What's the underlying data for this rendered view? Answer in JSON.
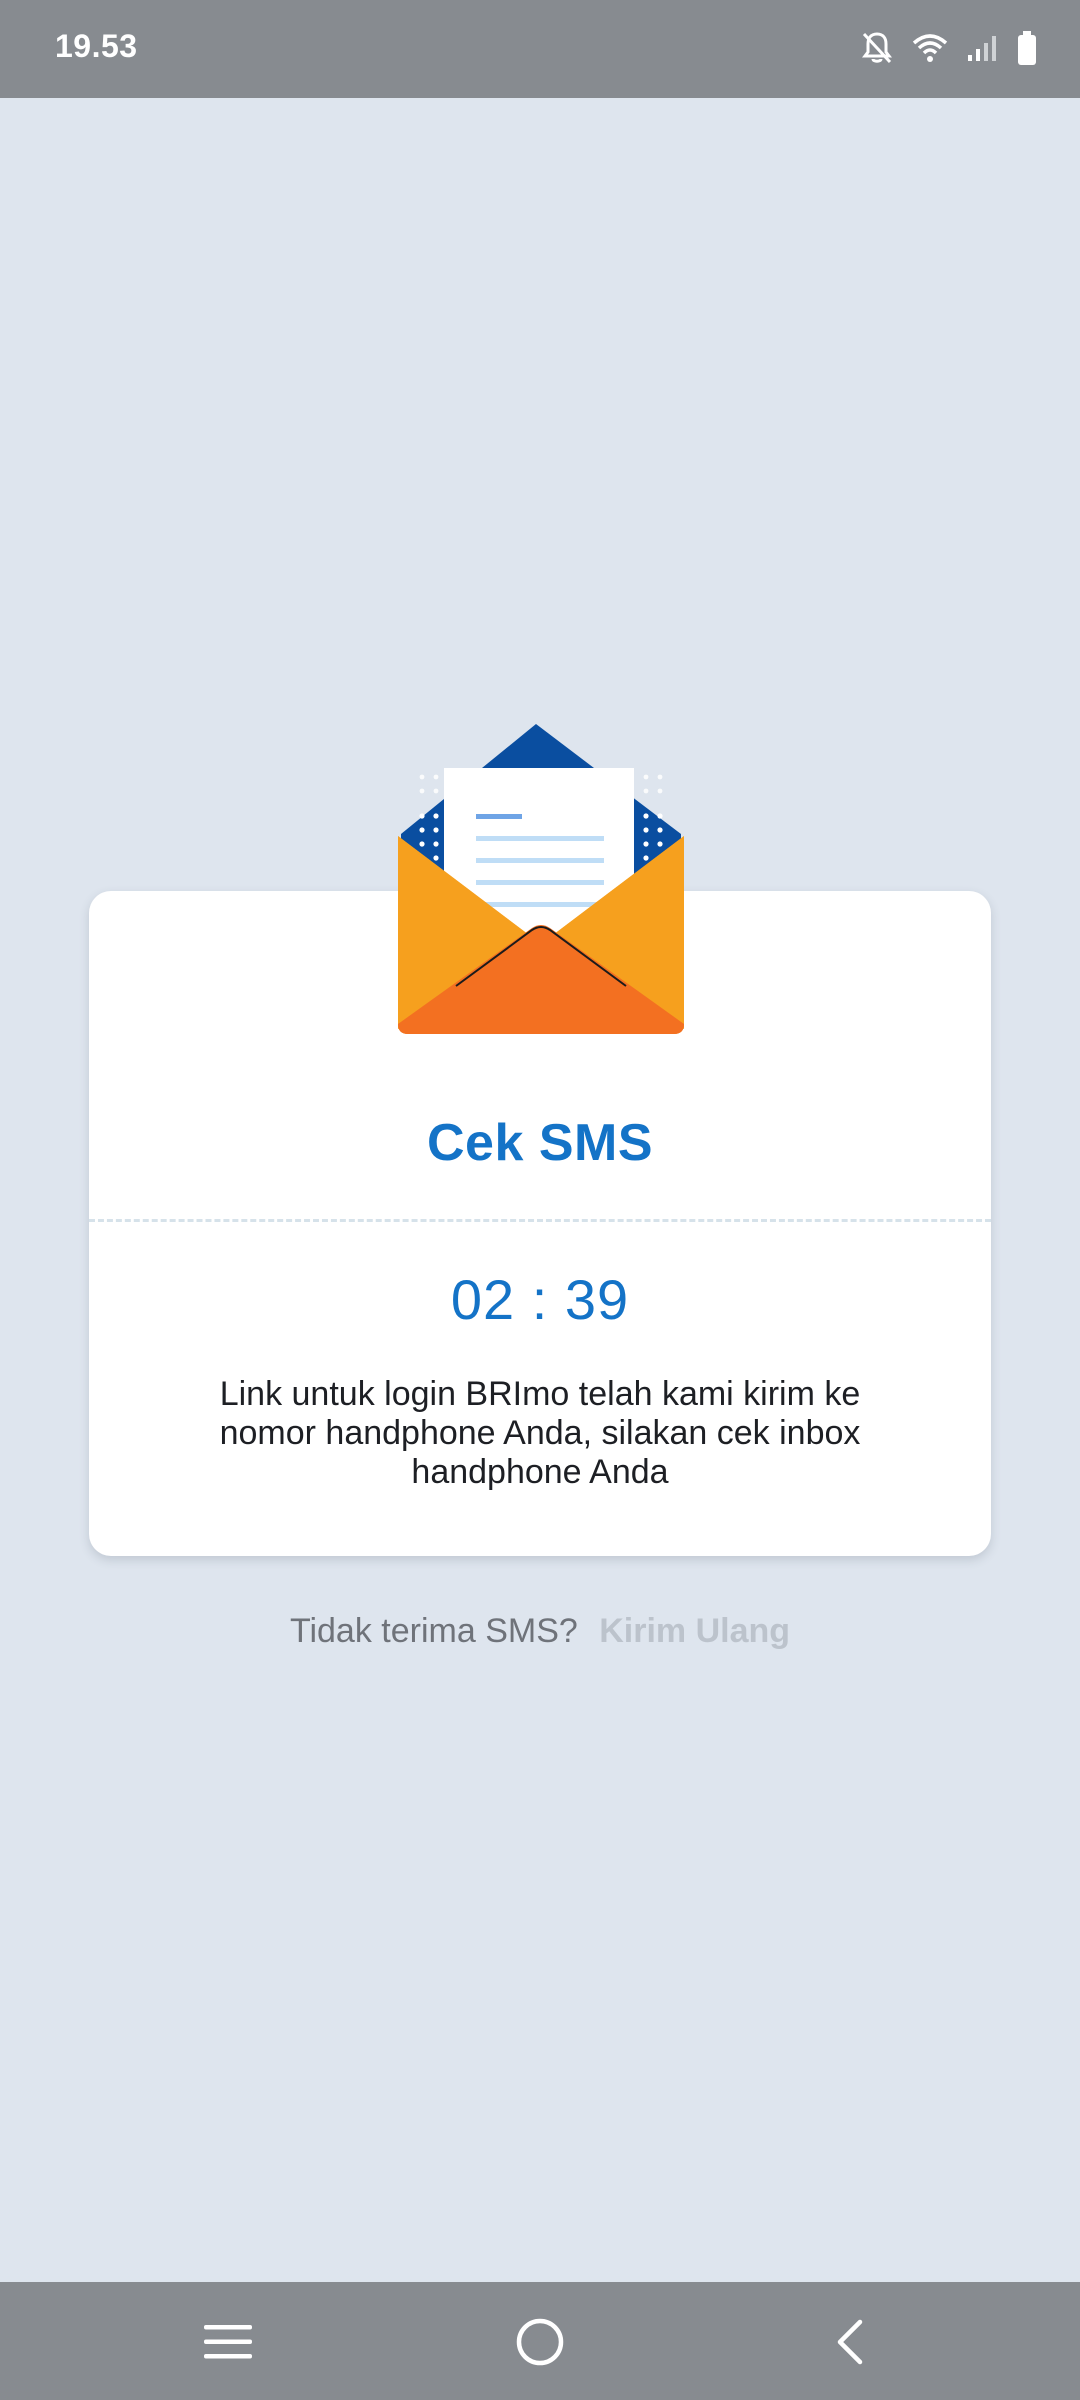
{
  "status_bar": {
    "time": "19.53",
    "icons": [
      "notifications-off-icon",
      "wifi-icon",
      "signal-icon",
      "battery-icon"
    ]
  },
  "card": {
    "title": "Cek SMS",
    "timer": "02 : 39",
    "message": "Link untuk login BRImo telah kami kirim ke nomor handphone Anda, silakan cek inbox handphone Anda",
    "illustration": "open-envelope-icon"
  },
  "resend": {
    "prompt": "Tidak terima SMS?",
    "link_label": "Kirim Ulang"
  },
  "nav_bar": {
    "icons": [
      "menu-icon",
      "home-icon",
      "back-icon"
    ]
  },
  "colors": {
    "background": "#DEE5EE",
    "system_bars": "#878B90",
    "accent_blue": "#1473C7",
    "envelope_orange": "#F6A01E",
    "envelope_dark_orange": "#F37021",
    "envelope_navy": "#0A4EA0",
    "resend_disabled": "#BCC3CC"
  }
}
